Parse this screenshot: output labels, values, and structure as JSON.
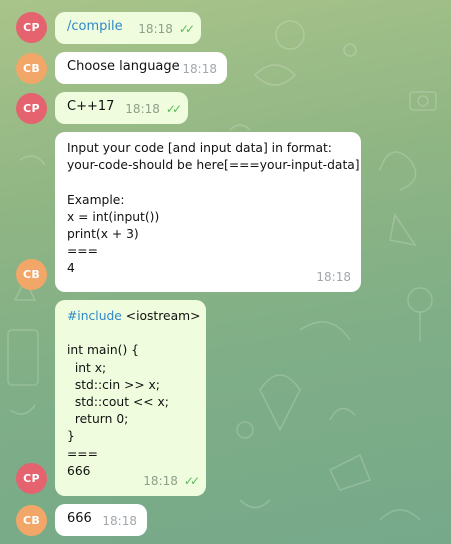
{
  "messages": [
    {
      "sender": "CP",
      "type": "out",
      "text": "/compile",
      "time": "18:18",
      "read": true
    },
    {
      "sender": "CB",
      "type": "in",
      "text": "Choose language",
      "time": "18:18"
    },
    {
      "sender": "CP",
      "type": "out",
      "text": "C++17",
      "time": "18:18",
      "read": true
    },
    {
      "sender": "CB",
      "type": "in",
      "text": "Input your code [and input data] in format:\nyour-code-should be here[===your-input-data]\n\nExample:\nx = int(input())\nprint(x + 3)\n===\n4",
      "time": "18:18"
    },
    {
      "sender": "CP",
      "type": "out",
      "text_hashtag": "#include",
      "text": " <iostream>\n\nint main() {\n  int x;\n  std::cin >> x;\n  std::cout << x;\n  return 0;\n}\n===\n666",
      "time": "18:18",
      "read": true
    },
    {
      "sender": "CB",
      "type": "in",
      "text": "666",
      "time": "18:18"
    }
  ],
  "colors": {
    "cp_avatar": "#e4636f",
    "cb_avatar": "#f2a769",
    "out_bubble": "#effdde",
    "in_bubble": "#ffffff",
    "link": "#2f88c8",
    "read_check": "#5cba58"
  },
  "icons": {
    "read_receipt": "double-check-icon"
  }
}
